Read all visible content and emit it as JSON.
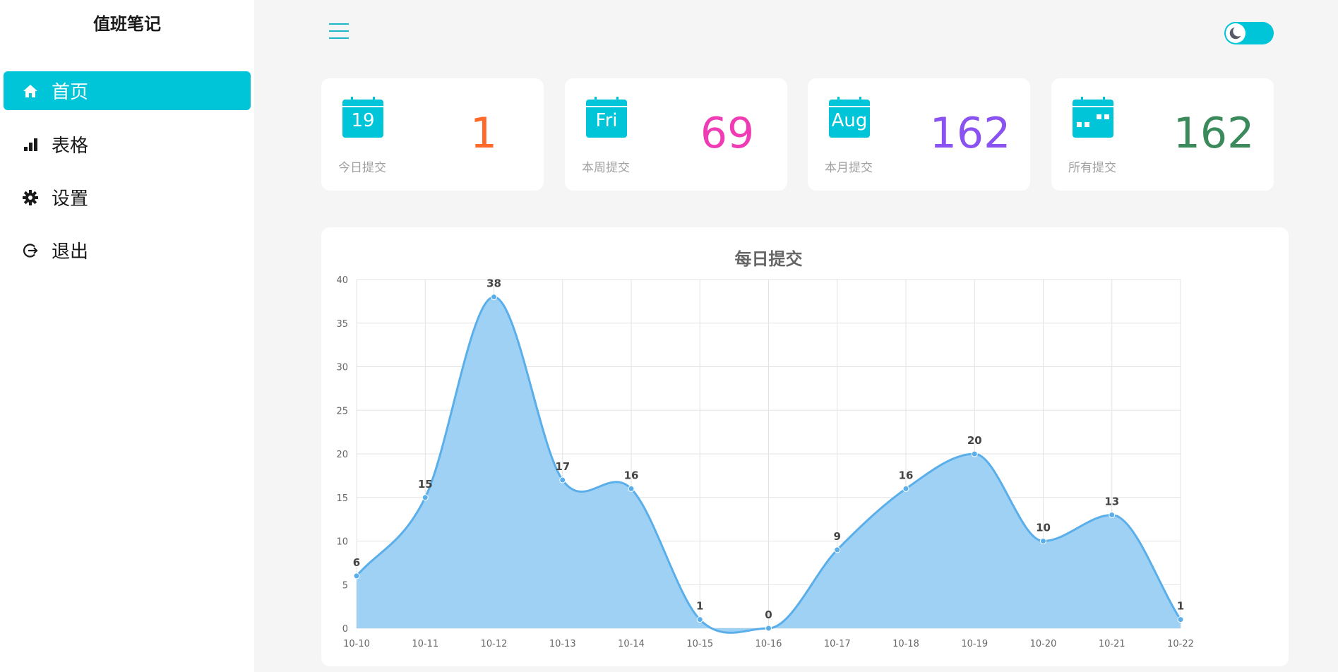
{
  "app": {
    "title": "值班笔记"
  },
  "sidebar": {
    "items": [
      {
        "label": "首页",
        "icon": "home-icon",
        "active": true
      },
      {
        "label": "表格",
        "icon": "bar-chart-icon",
        "active": false
      },
      {
        "label": "设置",
        "icon": "gear-icon",
        "active": false
      },
      {
        "label": "退出",
        "icon": "logout-icon",
        "active": false
      }
    ]
  },
  "header": {
    "menu_icon": "hamburger-menu-icon",
    "theme_toggle_icon": "moon-icon",
    "theme_toggle_on": true
  },
  "stats": [
    {
      "icon_text": "19",
      "label": "今日提交",
      "value": "1",
      "color": "#ff6a2b"
    },
    {
      "icon_text": "Fri",
      "label": "本周提交",
      "value": "69",
      "color": "#f03cb4"
    },
    {
      "icon_text": "Aug",
      "label": "本月提交",
      "value": "162",
      "color": "#8a52f0"
    },
    {
      "icon_text": "",
      "label": "所有提交",
      "value": "162",
      "color": "#3a8a5c"
    }
  ],
  "colors": {
    "accent": "#00c4d7",
    "line": "#5aafea",
    "fill": "#9acff4"
  },
  "chart_data": {
    "type": "area",
    "title": "每日提交",
    "x": [
      "10-10",
      "10-11",
      "10-12",
      "10-13",
      "10-14",
      "10-15",
      "10-16",
      "10-17",
      "10-18",
      "10-19",
      "10-20",
      "10-21",
      "10-22"
    ],
    "series": [
      {
        "values": [
          6,
          15,
          38,
          17,
          16,
          1,
          0,
          9,
          16,
          20,
          10,
          13,
          1
        ]
      }
    ],
    "ylim": [
      0,
      40
    ],
    "yticks": [
      0,
      5,
      10,
      15,
      20,
      25,
      30,
      35,
      40
    ],
    "grid": true,
    "data_labels": true,
    "smooth": true
  }
}
